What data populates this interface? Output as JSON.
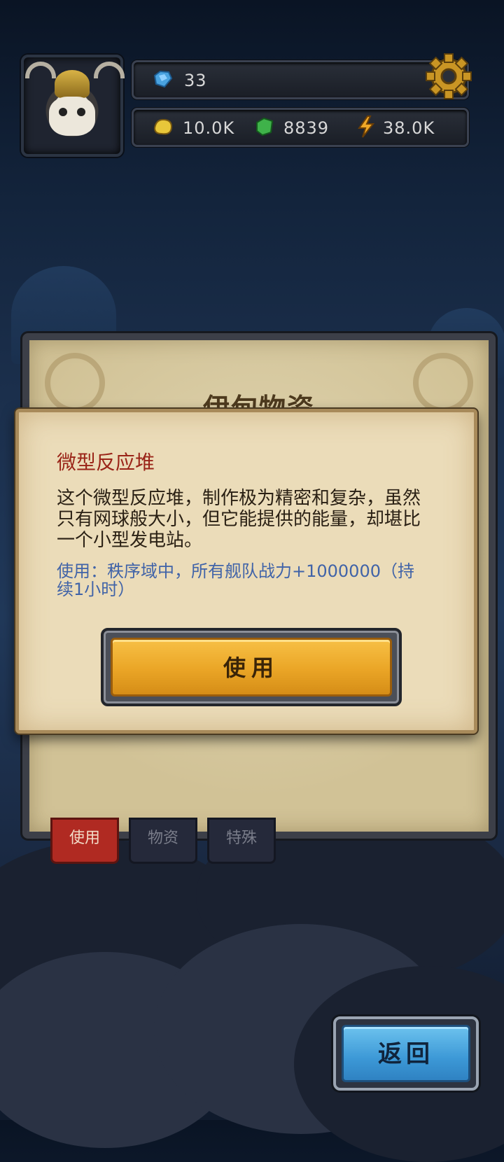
{
  "header": {
    "gems": "33",
    "gold": "10.0K",
    "supplies": "8839",
    "energy": "38.0K"
  },
  "panel": {
    "title": "伊甸物资",
    "tabs": [
      {
        "label": "使用",
        "active": true
      },
      {
        "label": "物资",
        "active": false
      },
      {
        "label": "特殊",
        "active": false
      }
    ]
  },
  "popup": {
    "item_name": "微型反应堆",
    "description": "这个微型反应堆，制作极为精密和复杂，虽然只有网球般大小，但它能提供的能量，却堪比一个小型发电站。",
    "effect": "使用：秩序域中，所有舰队战力+1000000（持续1小时）",
    "use_label": "使用"
  },
  "back_label": "返回",
  "colors": {
    "item_name": "#9a2418",
    "effect_text": "#4063a8",
    "use_button": "#eaa526",
    "back_button": "#3c98d6",
    "active_tab": "#b02a22"
  }
}
